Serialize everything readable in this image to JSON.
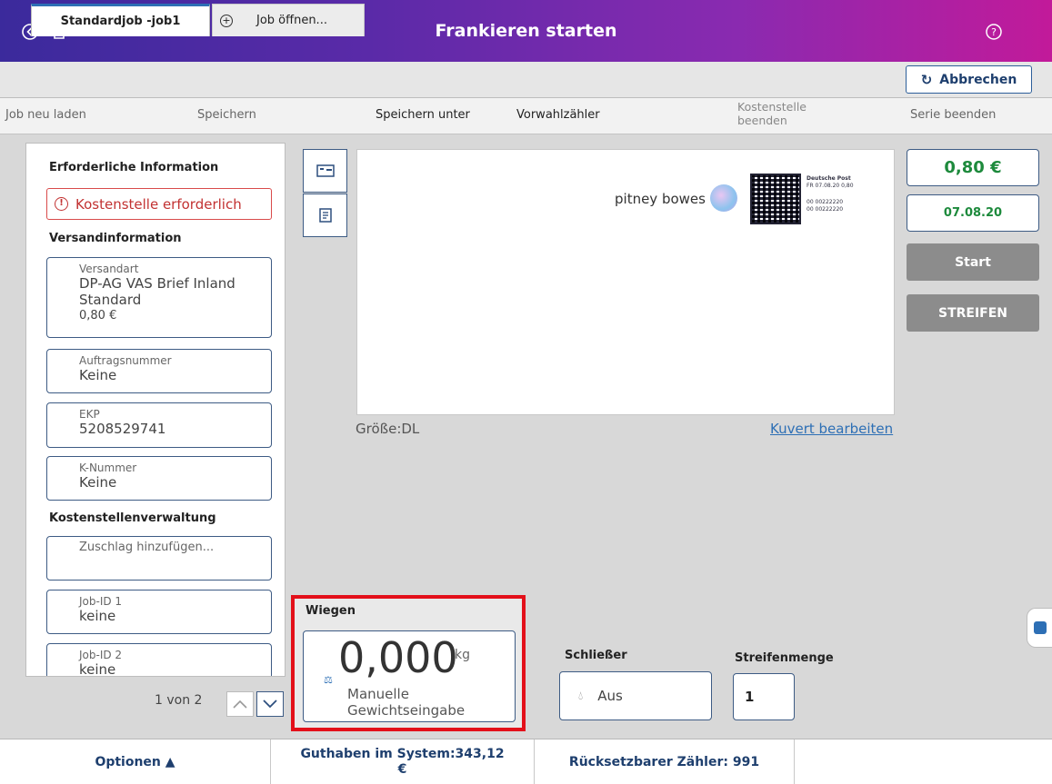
{
  "header": {
    "title": "Frankieren starten",
    "back_icon": "back-circle-icon",
    "home_icon": "home-icon",
    "help_icon": "help-circle-icon"
  },
  "tabs": {
    "active": "Standardjob -job1",
    "open": "Job öffnen...",
    "cancel": "Abbrechen"
  },
  "actions": {
    "reload": "Job neu laden",
    "save": "Speichern",
    "save_as": "Speichern unter",
    "preset_counter": "Vorwahlzähler",
    "end_cost_center_1": "Kostenstelle",
    "end_cost_center_2": "beenden",
    "end_series": "Serie beenden"
  },
  "left": {
    "required_title": "Erforderliche Information",
    "required_error": "Kostenstelle erforderlich",
    "shipping_title": "Versandinformation",
    "shipping_type_label": "Versandart",
    "shipping_type_line1": "DP-AG VAS Brief Inland",
    "shipping_type_line2": "Standard",
    "shipping_type_price": "0,80 €",
    "order_label": "Auftragsnummer",
    "order_value": "Keine",
    "ekp_label": "EKP",
    "ekp_value": "5208529741",
    "knum_label": "K-Nummer",
    "knum_value": "Keine",
    "cost_title": "Kostenstellenverwaltung",
    "surcharge_label": "Zuschlag hinzufügen...",
    "job1_label": "Job-ID 1",
    "job1_value": "keine",
    "job2_label": "Job-ID 2",
    "job2_value": "keine",
    "pager": "1 von 2"
  },
  "envelope": {
    "logo_text": "pitney bowes",
    "stamp_line1": "Deutsche Post",
    "stamp_line2": "FR 07.08.20 0,80",
    "stamp_line3": "00 00222220",
    "stamp_line4": "00 00222220",
    "size": "Größe:DL",
    "edit_link": "Kuvert bearbeiten"
  },
  "right": {
    "price": "0,80 €",
    "date": "07.08.20",
    "start": "Start",
    "strip": "STREIFEN"
  },
  "weigh": {
    "title": "Wiegen",
    "value": "0,000",
    "unit": "kg",
    "mode_line1": "Manuelle",
    "mode_line2": "Gewichtseingabe"
  },
  "sealer": {
    "label": "Schließer",
    "value": "Aus"
  },
  "strip_qty": {
    "label": "Streifenmenge",
    "value": "1"
  },
  "footer": {
    "options": "Optionen ▲",
    "balance_line1": "Guthaben im System:343,12",
    "balance_line2": "€",
    "counter": "Rücksetzbarer Zähler: 991"
  },
  "colors": {
    "header_start": "#3b2a9c",
    "header_end": "#c21a9a",
    "accent_blue": "#2d6fb5",
    "error_red": "#c23232",
    "price_green": "#1d8a3c",
    "highlight_red": "#e3101a"
  }
}
